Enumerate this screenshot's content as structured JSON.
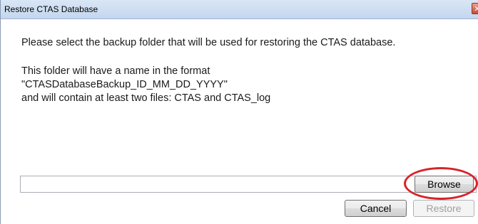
{
  "window": {
    "title": "Restore CTAS Database",
    "close_glyph": "✕"
  },
  "message": {
    "line1": "Please select the backup folder that will be used for restoring the CTAS database.",
    "line2": "This folder will have a name in the format",
    "line3": "\"CTASDatabaseBackup_ID_MM_DD_YYYY\"",
    "line4": "and will contain at least two files: CTAS and CTAS_log"
  },
  "folder_path": {
    "value": "",
    "placeholder": ""
  },
  "buttons": {
    "browse_label": "Browse",
    "cancel_label": "Cancel",
    "restore_label": "Restore",
    "restore_enabled": false
  },
  "colors": {
    "highlight": "#d8232a",
    "titlebar": "#c4d6ee"
  }
}
